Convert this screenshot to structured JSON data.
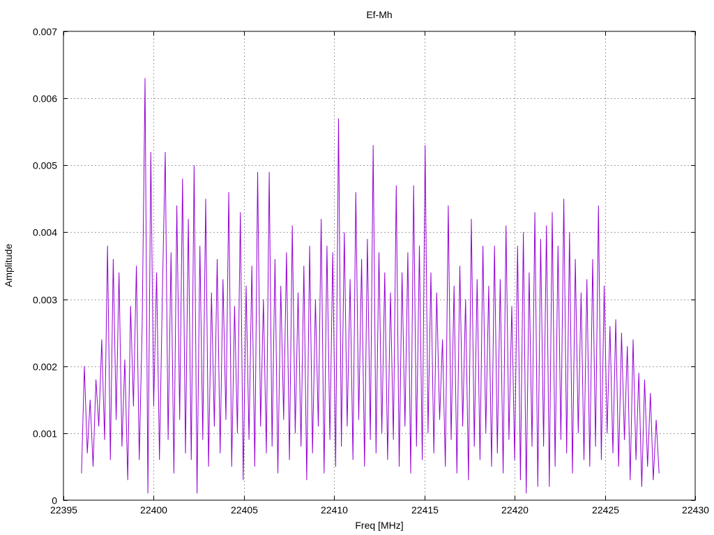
{
  "chart_data": {
    "type": "line",
    "title": "Ef-Mh",
    "xlabel": "Freq [MHz]",
    "ylabel": "Amplitude",
    "xlim": [
      22395,
      22430
    ],
    "ylim": [
      0,
      0.007
    ],
    "xticks": [
      22395,
      22400,
      22405,
      22410,
      22415,
      22420,
      22425,
      22430
    ],
    "yticks": [
      0,
      0.001,
      0.002,
      0.003,
      0.004,
      0.005,
      0.006,
      0.007
    ],
    "ytick_labels": [
      "0",
      "0.001",
      "0.002",
      "0.003",
      "0.004",
      "0.005",
      "0.006",
      "0.007"
    ],
    "grid": true,
    "legend": "none",
    "series": [
      {
        "name": "Ef-Mh",
        "color": "#9400d3",
        "x_start": 22396.0,
        "x_step": 0.16,
        "y": [
          0.0004,
          0.002,
          0.0007,
          0.0015,
          0.0005,
          0.0018,
          0.0011,
          0.0024,
          0.0009,
          0.0038,
          0.0006,
          0.0036,
          0.0012,
          0.0034,
          0.0008,
          0.0021,
          0.0003,
          0.0029,
          0.0014,
          0.0035,
          0.0006,
          0.0026,
          0.0063,
          0.0001,
          0.0052,
          0.0014,
          0.0034,
          0.0006,
          0.0031,
          0.0052,
          0.0009,
          0.0037,
          0.0004,
          0.0044,
          0.0012,
          0.0048,
          0.0007,
          0.0042,
          0.0006,
          0.005,
          0.0001,
          0.0038,
          0.0009,
          0.0045,
          0.0005,
          0.0031,
          0.0011,
          0.0036,
          0.0007,
          0.0033,
          0.0012,
          0.0046,
          0.0005,
          0.0029,
          0.001,
          0.0043,
          0.0003,
          0.0032,
          0.0009,
          0.0035,
          0.0005,
          0.0049,
          0.0011,
          0.003,
          0.0007,
          0.0049,
          0.0008,
          0.0036,
          0.0004,
          0.0032,
          0.0012,
          0.0037,
          0.0006,
          0.0041,
          0.001,
          0.0031,
          0.0008,
          0.0035,
          0.0003,
          0.0038,
          0.0007,
          0.003,
          0.0011,
          0.0042,
          0.0004,
          0.0038,
          0.0009,
          0.0037,
          0.0005,
          0.0057,
          0.0008,
          0.004,
          0.0011,
          0.0033,
          0.0006,
          0.0046,
          0.0012,
          0.0036,
          0.0005,
          0.0039,
          0.0009,
          0.0053,
          0.0007,
          0.0037,
          0.001,
          0.0034,
          0.0006,
          0.0031,
          0.0009,
          0.0047,
          0.0005,
          0.0034,
          0.0011,
          0.0037,
          0.0004,
          0.0047,
          0.0008,
          0.0038,
          0.0006,
          0.0053,
          0.001,
          0.0034,
          0.0007,
          0.0031,
          0.0012,
          0.0024,
          0.0005,
          0.0044,
          0.0009,
          0.0032,
          0.0004,
          0.0035,
          0.0011,
          0.003,
          0.0003,
          0.0042,
          0.0008,
          0.0033,
          0.0006,
          0.0038,
          0.001,
          0.0032,
          0.0005,
          0.0038,
          0.0007,
          0.0033,
          0.0004,
          0.0041,
          0.0009,
          0.0029,
          0.0006,
          0.0038,
          0.0003,
          0.004,
          0.0001,
          0.0034,
          0.0008,
          0.0043,
          0.0002,
          0.0039,
          0.0008,
          0.0041,
          0.0002,
          0.0043,
          0.0005,
          0.0038,
          0.0009,
          0.0045,
          0.0007,
          0.004,
          0.0004,
          0.0036,
          0.001,
          0.0031,
          0.0006,
          0.0033,
          0.0005,
          0.0036,
          0.0008,
          0.0044,
          0.0006,
          0.0032,
          0.001,
          0.0026,
          0.0007,
          0.0027,
          0.0005,
          0.0025,
          0.0009,
          0.0023,
          0.0003,
          0.0024,
          0.0006,
          0.0019,
          0.0002,
          0.0018,
          0.0005,
          0.0016,
          0.0003,
          0.0012,
          0.0004
        ]
      }
    ]
  }
}
